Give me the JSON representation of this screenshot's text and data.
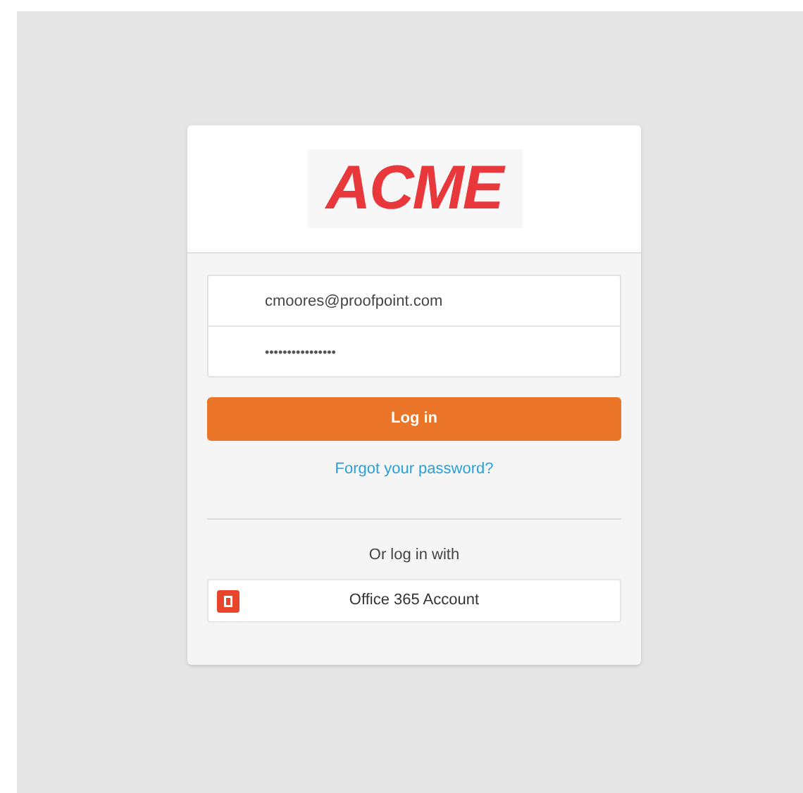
{
  "logo": {
    "text": "ACME"
  },
  "email": {
    "value": "cmoores@proofpoint.com"
  },
  "password": {
    "value": "••••••••••••••••"
  },
  "login_button": {
    "label": "Log in"
  },
  "forgot_link": {
    "label": "Forgot your password?"
  },
  "alt_login": {
    "label": "Or log in with",
    "provider_button": {
      "label": "Office 365 Account"
    }
  }
}
